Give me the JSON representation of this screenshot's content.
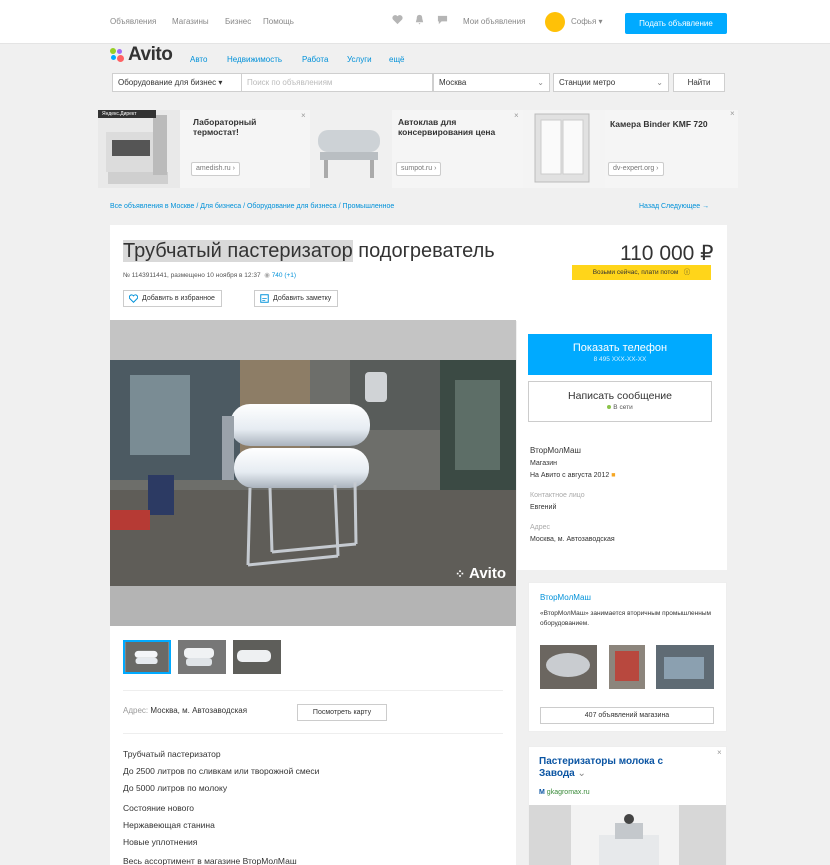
{
  "topbar": {
    "links": [
      "Объявления",
      "Магазины",
      "Бизнес",
      "Помощь"
    ],
    "my_ads": "Мои объявления",
    "user_name": "Софья",
    "post_ad": "Подать объявление"
  },
  "logo": {
    "text": "Avito"
  },
  "nav": [
    "Авто",
    "Недвижимость",
    "Работа",
    "Услуги",
    "ещё"
  ],
  "search": {
    "category": "Оборудование для бизнес",
    "placeholder": "Поиск по объявлениям",
    "city": "Москва",
    "metro": "Станции метро",
    "button": "Найти"
  },
  "ads": [
    {
      "title": "Лабораторный термостат!",
      "domain": "amedish.ru ›",
      "corner_label": "Яндекс.Директ"
    },
    {
      "title": "Автоклав для консервирования цена",
      "domain": "sumpot.ru ›"
    },
    {
      "title": "Камера Binder KMF 720",
      "domain": "dv-expert.org ›"
    }
  ],
  "breadcrumb": "Все объявления в Москве / Для бизнеса / Оборудование для бизнеса / Промышленное",
  "pager": "Назад   Следующее →",
  "item": {
    "title_highlight": "Трубчатый пастеризатор",
    "title_rest": " подогреватель",
    "price": "110 000 ₽",
    "buy_now": "Возьми сейчас, плати потом",
    "meta": "№ 1143911441, размещено 10 ноября в 12:37",
    "views": "740 (+1)",
    "add_favorite": "Добавить в избранное",
    "add_note": "Добавить заметку",
    "watermark": "Avito",
    "address_label": "Адрес:",
    "address": "Москва, м. Автозаводская",
    "map_button": "Посмотреть карту",
    "description": [
      "Трубчатый пастеризатор",
      "До 2500 литров по сливкам или творожной смеси",
      "До 5000 литров по молоку",
      "Состояние нового",
      "Нержавеющая станина",
      "Новые уплотнения",
      "Весь ассортимент в магазине ВторМолМаш"
    ]
  },
  "contact": {
    "show_phone": "Показать телефон",
    "phone_masked": "8 495 XXX-XX-XX",
    "write_message": "Написать сообщение",
    "online": "В сети",
    "seller_name": "ВторМолМаш",
    "seller_type": "Магазин",
    "since": "На Авито с августа 2012",
    "contact_label": "Контактное лицо",
    "contact_person": "Евгений",
    "address_label": "Адрес",
    "address": "Москва, м. Автозаводская"
  },
  "store": {
    "name": "ВторМолМаш",
    "description": "«ВторМолМаш» занимается вторичным промышленным оборудованием.",
    "ads_button": "407 объявлений магазина"
  },
  "ad_bottom": {
    "title": "Пастеризаторы молока с Завода",
    "domain": "gkagromax.ru"
  },
  "colors": {
    "accent": "#00aaff",
    "link": "#0091d9",
    "buy_now": "#ffd51a"
  }
}
